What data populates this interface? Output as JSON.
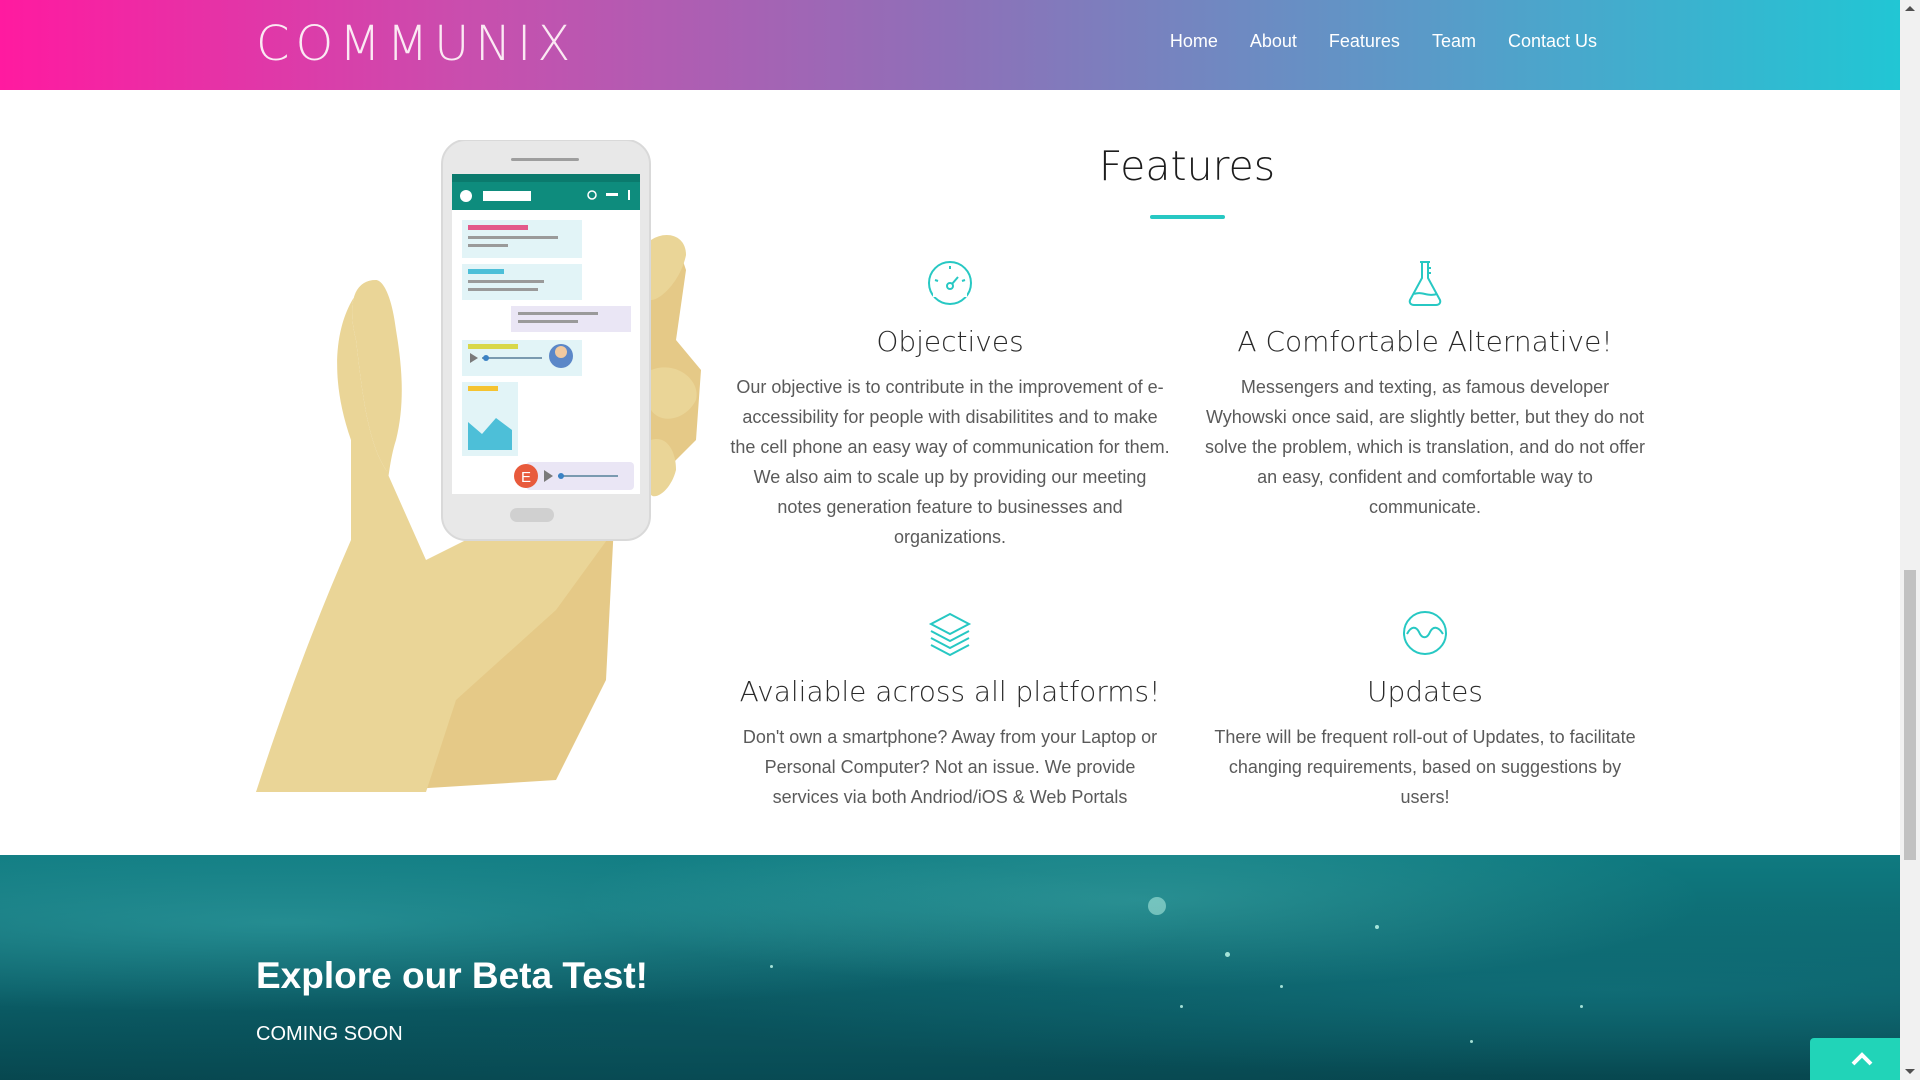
{
  "header": {
    "logo": "COMMUNIX",
    "nav": [
      "Home",
      "About",
      "Features",
      "Team",
      "Contact Us"
    ]
  },
  "features": {
    "title": "Features",
    "items": [
      {
        "icon": "speedometer-icon",
        "title": "Objectives",
        "text": "Our objective is to contribute in the improvement of e-accessibility for people with disabilitites and to make the cell phone an easy way of communication for them. We also aim to scale up by providing our meeting notes generation feature to businesses and organizations."
      },
      {
        "icon": "flask-icon",
        "title": "A Comfortable Alternative!",
        "text": "Messengers and texting, as famous developer Wyhowski once said, are slightly better, but they do not solve the problem, which is translation, and do not offer an easy, confident and comfortable way to communicate."
      },
      {
        "icon": "layers-icon",
        "title": "Avaliable across all platforms!",
        "text": "Don't own a smartphone? Away from your Laptop or Personal Computer? Not an issue. We provide services via both Andriod/iOS & Web Portals"
      },
      {
        "icon": "wave-circle-icon",
        "title": "Updates",
        "text": "There will be frequent roll-out of Updates, to facilitate changing requirements, based on suggestions by users!"
      }
    ]
  },
  "beta": {
    "title": "Explore our Beta Test!",
    "subtitle": "COMING SOON"
  },
  "colors": {
    "accent": "#27c8c3",
    "header_start": "#ff1aa0",
    "header_end": "#21c6d4",
    "back_to_top": "#21d4b8"
  },
  "phone_illustration": {
    "avatar_letter": "E"
  }
}
